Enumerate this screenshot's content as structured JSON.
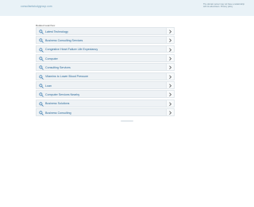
{
  "header": {
    "domain": "consultantstudygroup.com",
    "notice": "The domain owner may not have a relationship with its advertisers. Privacy policy"
  },
  "related": {
    "heading": "Related searches:",
    "items": [
      {
        "label": "Latest Technology"
      },
      {
        "label": "Business Consulting Services"
      },
      {
        "label": "Congestive Heart Failure Life Expectancy"
      },
      {
        "label": "Computer"
      },
      {
        "label": "Consulting Services"
      },
      {
        "label": "Vitamins to Lower Blood Pressure"
      },
      {
        "label": "Loan"
      },
      {
        "label": "Computer Services Nearby"
      },
      {
        "label": "Business Solutions"
      },
      {
        "label": "Business Consulting"
      }
    ]
  },
  "colors": {
    "topbar": "#e9f2f7",
    "link": "#2b6a9a",
    "row_bg": "#eef2f5",
    "icon": "#3a7bb0"
  }
}
